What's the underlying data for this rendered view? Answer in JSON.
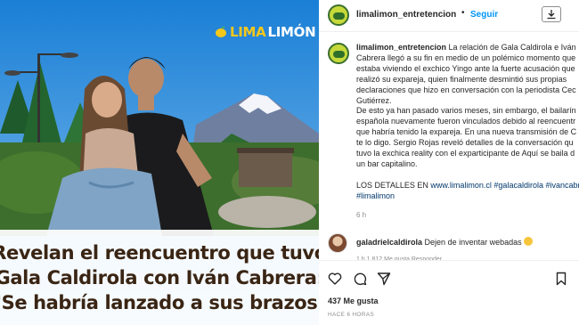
{
  "image": {
    "brand_logo": {
      "part1": "LIMA",
      "part2": "LIMÓN"
    },
    "headline": [
      "Revelan el reencuentro que tuvo",
      "Gala Caldirola con Iván Cabrera:",
      "\"Se habría lanzado a sus brazos\""
    ]
  },
  "header": {
    "username": "limalimon_entretencion",
    "separator": "•",
    "follow_label": "Seguir"
  },
  "caption": {
    "username": "limalimon_entretencion",
    "lines": [
      " La relación de Gala Caldirola e Iván",
      "Cabrera llegó a su fin en medio de un polémico momento que",
      "estaba viviendo el exchico Yingo ante la fuerte acusación que",
      "realizó su expareja, quien finalmente desmintió sus propias",
      "declaraciones que hizo en conversación con la periodista Cec",
      "Gutiérrez.",
      "De esto ya han pasado varios meses, sin embargo, el bailarín",
      "española nuevamente fueron vinculados debido al reencuentr",
      "que habría tenido la expareja. En una nueva transmisión de C",
      "te lo digo. Sergio Rojas reveló detalles de la conversación qu",
      "tuvo la exchica reality con el exparticipante de Aquí se baila d",
      "un bar capitalino."
    ],
    "details_prefix": "LOS DETALLES EN",
    "details_link": "www.limalimon.cl",
    "hashtag_1": "#galacaldirola",
    "hashtag_2": "#ivancabr",
    "hashtag_3": "#limalimon",
    "time": "6 h"
  },
  "reply": {
    "username": "galadrielcaldirola",
    "text": "Dejen de inventar webadas",
    "meta": "1 h   1.812 Me gusta   Responder"
  },
  "actions": {
    "likes": "437 Me gusta",
    "posted": "HACE 6 HORAS"
  },
  "colors": {
    "follow_blue": "#0095f6",
    "link_blue": "#00376b",
    "muted_gray": "#8e8e8e",
    "logo_yellow": "#f4c71b",
    "headline_brown": "#3a2514"
  }
}
